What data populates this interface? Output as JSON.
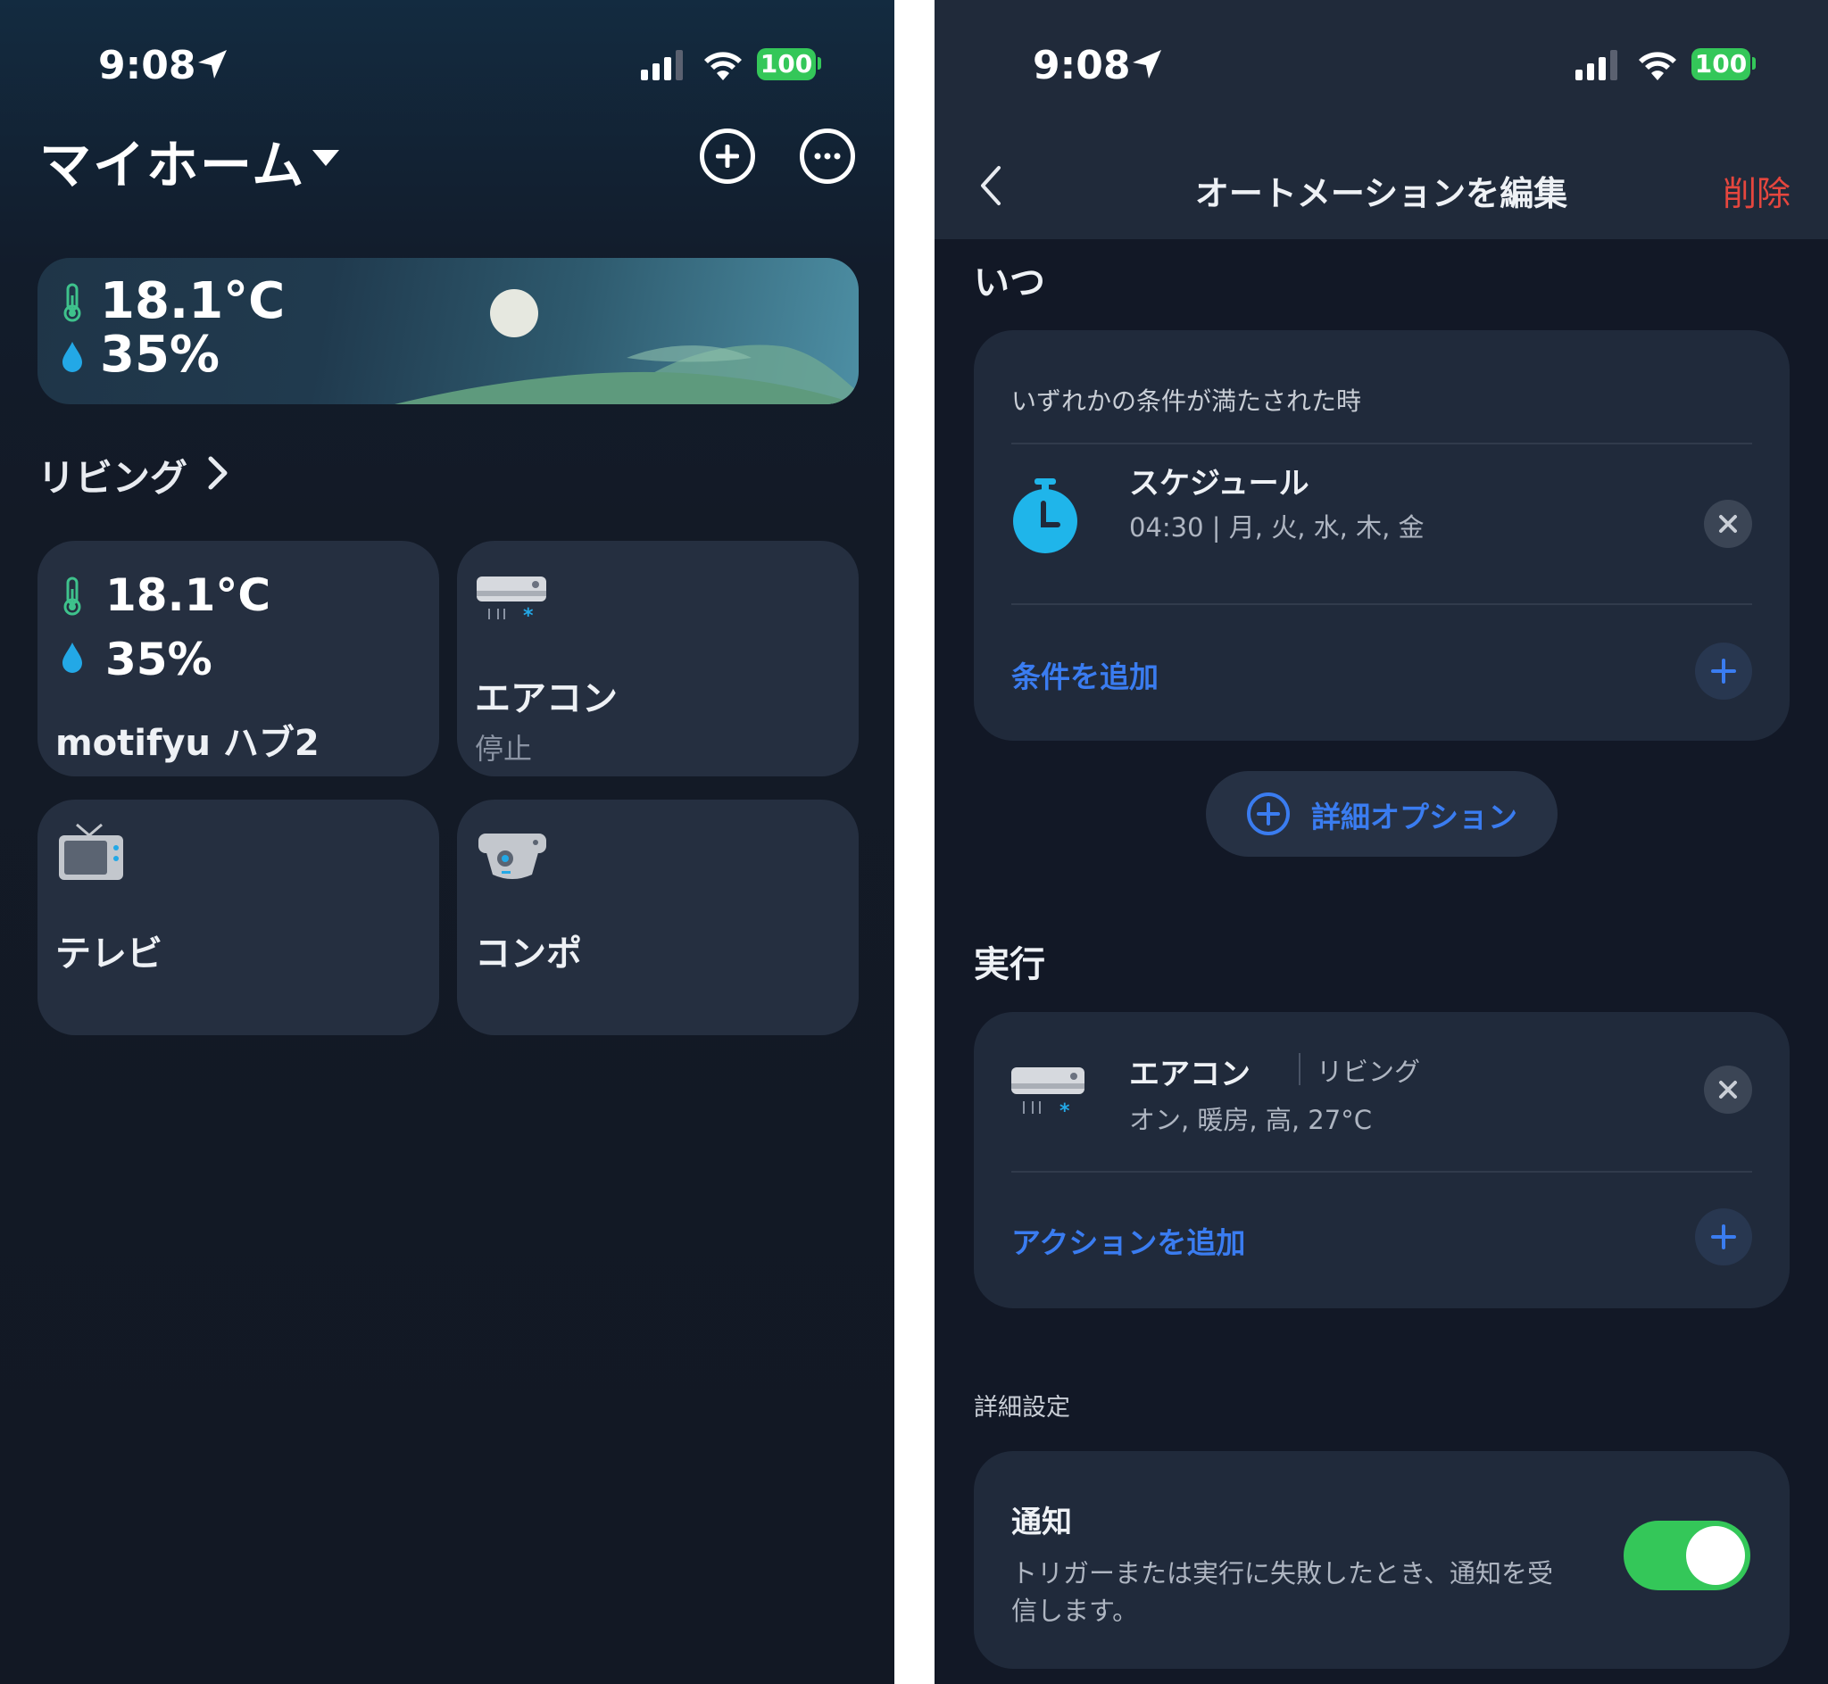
{
  "left": {
    "status": {
      "time": "9:08",
      "battery": "100"
    },
    "home_title": "マイホーム",
    "weather": {
      "temperature": "18.1°C",
      "humidity": "35%"
    },
    "room_link": "リビング",
    "tiles": [
      {
        "temperature": "18.1°C",
        "humidity": "35%",
        "name": "motifyu ハブ2"
      },
      {
        "icon": "air-conditioner-icon",
        "name": "エアコン",
        "status": "停止"
      },
      {
        "icon": "tv-icon",
        "name": "テレビ"
      },
      {
        "icon": "stereo-icon",
        "name": "コンポ"
      }
    ]
  },
  "right": {
    "status": {
      "time": "9:08",
      "battery": "100"
    },
    "nav": {
      "title": "オートメーションを編集",
      "delete_label": "削除"
    },
    "when": {
      "heading": "いつ",
      "condition_desc": "いずれかの条件が満たされた時",
      "trigger": {
        "icon": "timer-icon",
        "title": "スケジュール",
        "detail": "04:30 | 月, 火, 水, 木, 金"
      },
      "add_condition": "条件を追加"
    },
    "advanced_options": "詳細オプション",
    "execute": {
      "heading": "実行",
      "action": {
        "icon": "air-conditioner-icon",
        "title": "エアコン",
        "room": "リビング",
        "detail": "オン, 暖房, 高, 27°C"
      },
      "add_action": "アクションを追加"
    },
    "settings": {
      "heading": "詳細設定",
      "notify_title": "通知",
      "notify_desc_1": "トリガーまたは実行に失敗したとき、通知を受",
      "notify_desc_2": "信します。",
      "notify_enabled": true
    },
    "colors": {
      "accent": "#3a7cf0",
      "danger": "#e5463e",
      "toggle_on": "#34c759",
      "timer": "#1fb5ea"
    }
  }
}
